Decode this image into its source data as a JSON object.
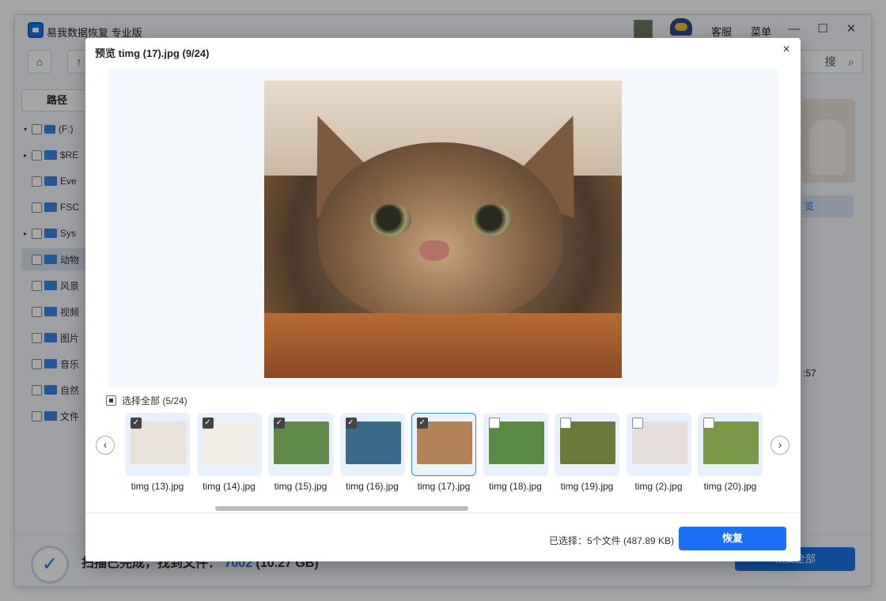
{
  "app": {
    "title": "易我数据恢复 专业版",
    "links": [
      "客服",
      "菜单"
    ],
    "controls": [
      "—",
      "☐",
      "✕"
    ]
  },
  "toolbar": {
    "home_icon": "⌂",
    "up_icon": "↑",
    "search_icon": "⌕",
    "search_placeholder": "搜"
  },
  "left_panel": {
    "tab": "路径",
    "items": [
      {
        "label": "(F:)",
        "expand": "▾",
        "icon": "drive"
      },
      {
        "label": "$RE",
        "expand": "▸",
        "icon": "folder"
      },
      {
        "label": "Eve",
        "expand": "",
        "icon": "folder"
      },
      {
        "label": "FSC",
        "expand": "",
        "icon": "folder"
      },
      {
        "label": "Sys",
        "expand": "▸",
        "icon": "folder"
      },
      {
        "label": "动物",
        "expand": "",
        "icon": "folder"
      },
      {
        "label": "风景",
        "expand": "",
        "icon": "folder"
      },
      {
        "label": "视频",
        "expand": "",
        "icon": "folder"
      },
      {
        "label": "图片",
        "expand": "",
        "icon": "folder"
      },
      {
        "label": "音乐",
        "expand": "",
        "icon": "folder"
      },
      {
        "label": "自然",
        "expand": "",
        "icon": "folder"
      },
      {
        "label": "文件",
        "expand": "",
        "icon": "folder"
      }
    ]
  },
  "right_panel": {
    "preview_button": "览",
    "time": ":57"
  },
  "bottom": {
    "status_prefix": "扫描已完成，找到文件：",
    "count": "7002",
    "size": "(10.27 GB)",
    "recover_all": "恢复全部"
  },
  "modal": {
    "title": "预览 timg (17).jpg  (9/24)",
    "close": "×",
    "select_all": "选择全部  (5/24)",
    "prev": "‹",
    "next": "›",
    "thumbnails": [
      {
        "name": "timg (13).jpg",
        "checked": true,
        "color": "#e8e2da"
      },
      {
        "name": "timg (14).jpg",
        "checked": true,
        "color": "#f2ede6"
      },
      {
        "name": "timg (15).jpg",
        "checked": true,
        "color": "#5f8a4a"
      },
      {
        "name": "timg (16).jpg",
        "checked": true,
        "color": "#3a6a8a"
      },
      {
        "name": "timg (17).jpg",
        "checked": true,
        "color": "#b48458",
        "current": true
      },
      {
        "name": "timg (18).jpg",
        "checked": false,
        "color": "#5a8a44"
      },
      {
        "name": "timg (19).jpg",
        "checked": false,
        "color": "#6a7a3a"
      },
      {
        "name": "timg (2).jpg",
        "checked": false,
        "color": "#e6dedc"
      },
      {
        "name": "timg (20).jpg",
        "checked": false,
        "color": "#7a9a4a"
      }
    ],
    "selected_info": "已选择：5个文件 (487.89 KB)",
    "recover": "恢复"
  }
}
